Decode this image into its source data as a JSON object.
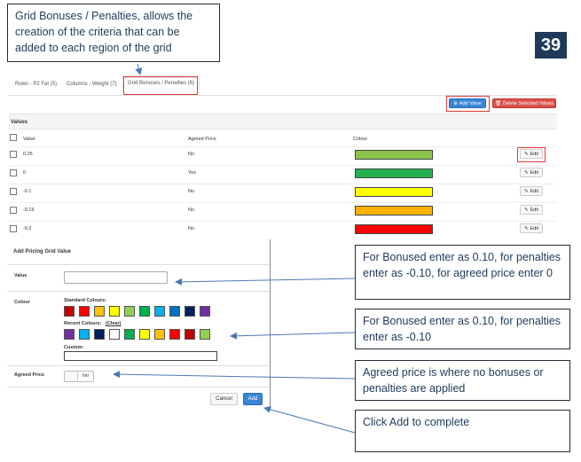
{
  "callouts": {
    "top": "Grid Bonuses / Penalties, allows the creation of the criteria that can be added to each region of the grid",
    "value": "For Bonused enter as 0.10, for penalties enter as -0.10, for agreed price enter 0",
    "colour": "For Bonused enter as 0.10, for penalties enter as -0.10",
    "agreed": "Agreed price is where no bonuses or penalties are applied",
    "add": "Click Add to complete"
  },
  "page_number": "39",
  "tabs": [
    "Rows - P2 Fat (5)",
    "Columns - Weight (7)",
    "Grid Bonuses / Penalties (6)"
  ],
  "toolbar": {
    "add_value": "Add Value",
    "delete_selected": "Delete Selected Values"
  },
  "table": {
    "section_title": "Values",
    "headers": {
      "value": "Value",
      "agreed": "Agreed Price",
      "colour": "Colour"
    },
    "rows": [
      {
        "value": "0.25",
        "agreed": "No",
        "colour": "#8bc34a"
      },
      {
        "value": "0",
        "agreed": "Yes",
        "colour": "#22b14c"
      },
      {
        "value": "-0.1",
        "agreed": "No",
        "colour": "#ffff00"
      },
      {
        "value": "-0.15",
        "agreed": "No",
        "colour": "#ffb300"
      },
      {
        "value": "-0.2",
        "agreed": "No",
        "colour": "#ff0000"
      }
    ],
    "edit_label": "Edit"
  },
  "modal": {
    "title": "Add Pricing Grid Value",
    "value_label": "Value",
    "colour_label": "Colour",
    "standard_colours_label": "Standard Colours:",
    "standard_colours": [
      "#c00000",
      "#ff0000",
      "#ffc000",
      "#ffff00",
      "#92d050",
      "#00b050",
      "#00b0f0",
      "#0070c0",
      "#002060",
      "#7030a0"
    ],
    "recent_colours_label": "Recent Colours:",
    "clear_label": "(Clear)",
    "recent_colours": [
      "#7030a0",
      "#00b0f0",
      "#002060",
      "#ffffff",
      "#00b050",
      "#ffff00",
      "#ffc000",
      "#ff0000",
      "#c00000",
      "#92d050"
    ],
    "custom_label": "Custom:",
    "agreed_label": "Agreed Price",
    "toggle_text": "No",
    "cancel": "Cancel",
    "add": "Add"
  }
}
